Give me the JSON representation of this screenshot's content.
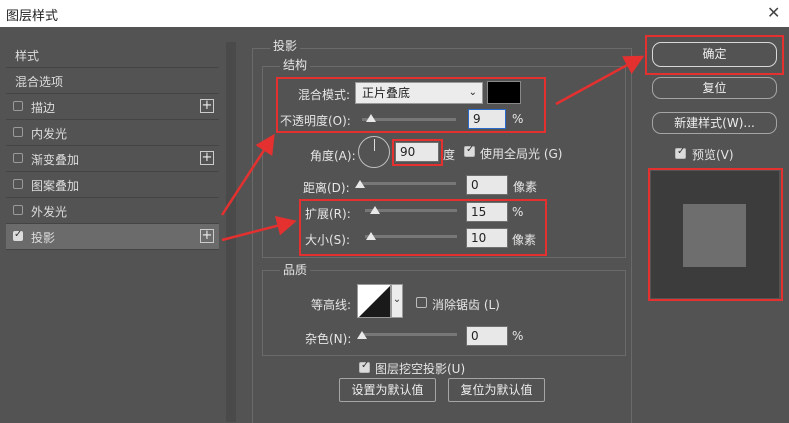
{
  "window": {
    "title": "图层样式",
    "close_glyph": "✕"
  },
  "sidebar": {
    "items": [
      {
        "label": "样式",
        "checkbox": false
      },
      {
        "label": "混合选项",
        "checkbox": false
      },
      {
        "label": "描边",
        "checkbox": true,
        "checked": false,
        "plus": "+"
      },
      {
        "label": "内发光",
        "checkbox": true,
        "checked": false
      },
      {
        "label": "渐变叠加",
        "checkbox": true,
        "checked": false,
        "plus": "+"
      },
      {
        "label": "图案叠加",
        "checkbox": true,
        "checked": false
      },
      {
        "label": "外发光",
        "checkbox": true,
        "checked": false
      },
      {
        "label": "投影",
        "checkbox": true,
        "checked": true,
        "plus": "+",
        "selected": true
      }
    ]
  },
  "shadow": {
    "section_title": "投影",
    "structure": {
      "legend": "结构",
      "blend_mode_label": "混合模式:",
      "blend_mode_value": "正片叠底",
      "blend_color": "#000000",
      "opacity_label": "不透明度(O):",
      "opacity_value": "9",
      "opacity_unit": "%",
      "angle_label": "角度(A):",
      "angle_value": "90",
      "angle_unit": "度",
      "global_light_label": "使用全局光 (G)",
      "global_light_checked": true,
      "distance_label": "距离(D):",
      "distance_value": "0",
      "distance_unit": "像素",
      "spread_label": "扩展(R):",
      "spread_value": "15",
      "spread_unit": "%",
      "size_label": "大小(S):",
      "size_value": "10",
      "size_unit": "像素"
    },
    "quality": {
      "legend": "品质",
      "contour_label": "等高线:",
      "antialias_label": "消除锯齿 (L)",
      "antialias_checked": false,
      "noise_label": "杂色(N):",
      "noise_value": "0",
      "noise_unit": "%"
    },
    "knockout_label": "图层挖空投影(U)",
    "knockout_checked": true,
    "set_default": "设置为默认值",
    "reset_default": "复位为默认值"
  },
  "buttons": {
    "ok": "确定",
    "reset": "复位",
    "new_style": "新建样式(W)...",
    "preview_label": "预览(V)",
    "preview_checked": true
  },
  "colors": {
    "highlight": "#e53030",
    "panel": "#535353"
  }
}
